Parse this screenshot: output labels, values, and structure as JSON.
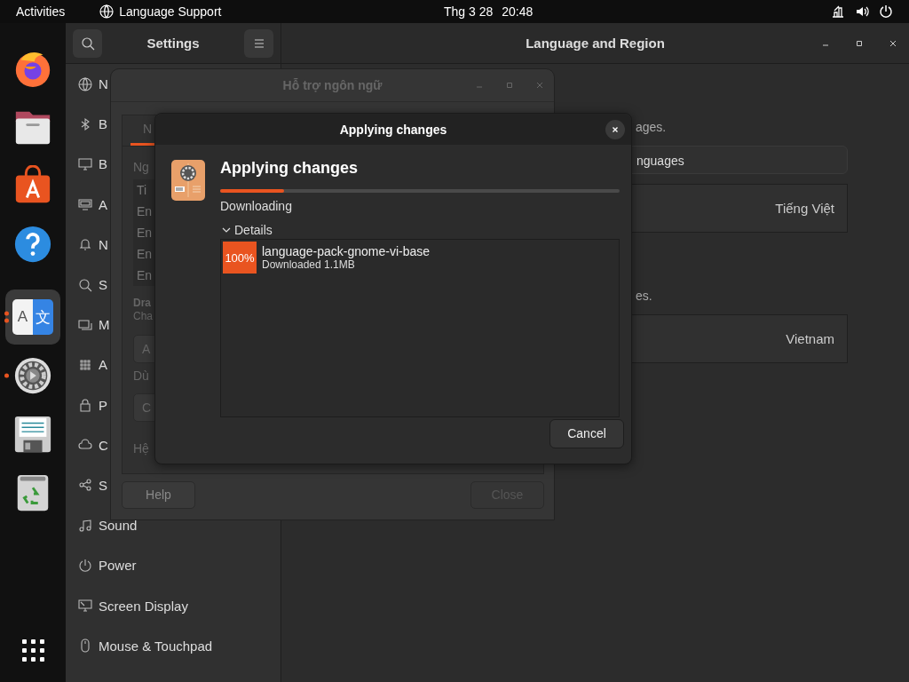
{
  "top_bar": {
    "activities": "Activities",
    "app_menu": "Language Support",
    "date": "Thg 3 28",
    "time": "20:48"
  },
  "dock": [
    {
      "running": false,
      "selected": false
    },
    {
      "running": false,
      "selected": false
    },
    {
      "running": false,
      "selected": false
    },
    {
      "running": false,
      "selected": false
    },
    {
      "running": true,
      "several_windows": true,
      "selected": true,
      "glyphs": [
        "A",
        "文"
      ]
    },
    {
      "running": true,
      "several_windows": false,
      "selected": false
    },
    {
      "running": false,
      "selected": false
    },
    {
      "running": false,
      "selected": false
    }
  ],
  "settings": {
    "title": "Settings",
    "page_title": "Language and Region",
    "sidebar": [
      {
        "label": "N"
      },
      {
        "label": "B"
      },
      {
        "label": "B"
      },
      {
        "label": "A"
      },
      {
        "label": "N"
      },
      {
        "label": "S"
      },
      {
        "label": "M"
      },
      {
        "label": "A"
      },
      {
        "label": "P"
      },
      {
        "label": "C"
      },
      {
        "label": "S"
      },
      {
        "label": "Sound"
      },
      {
        "label": "Power"
      },
      {
        "label": "Screen Display"
      },
      {
        "label": "Mouse & Touchpad"
      }
    ],
    "content": [
      {
        "kind": "text",
        "text": "ages."
      },
      {
        "kind": "button",
        "text": "nguages"
      },
      {
        "kind": "row",
        "value": "Tiếng Việt"
      },
      {
        "kind": "text",
        "text": "es."
      },
      {
        "kind": "row",
        "value": "Vietnam"
      }
    ]
  },
  "language_window": {
    "title": "Hỗ trợ ngôn ngữ",
    "tab": {
      "label": "N",
      "selected": true
    },
    "content": [
      {
        "kind": "label",
        "text": "Ng"
      },
      {
        "kind": "list",
        "items": [
          "Ti",
          "En",
          "En",
          "En",
          "En"
        ]
      },
      {
        "kind": "note",
        "bold": "Dra",
        "text": "Cha"
      },
      {
        "kind": "button",
        "text": "A"
      },
      {
        "kind": "label",
        "text": "Dù"
      },
      {
        "kind": "button",
        "text": "C"
      },
      {
        "kind": "label",
        "text": "Hệ"
      }
    ],
    "buttons": [
      {
        "label": "Help",
        "disabled": false
      },
      {
        "label": "Close",
        "disabled": true
      }
    ]
  },
  "dialog": {
    "title": "Applying changes",
    "heading": "Applying changes",
    "progress": {
      "level": 0.16
    },
    "status": "Downloading",
    "details": {
      "label": "Details",
      "expanded": true,
      "items": [
        {
          "badge": "100%",
          "name": "language-pack-gnome-vi-base",
          "info": "Downloaded 1.1MB"
        }
      ]
    },
    "cancel": "Cancel"
  }
}
